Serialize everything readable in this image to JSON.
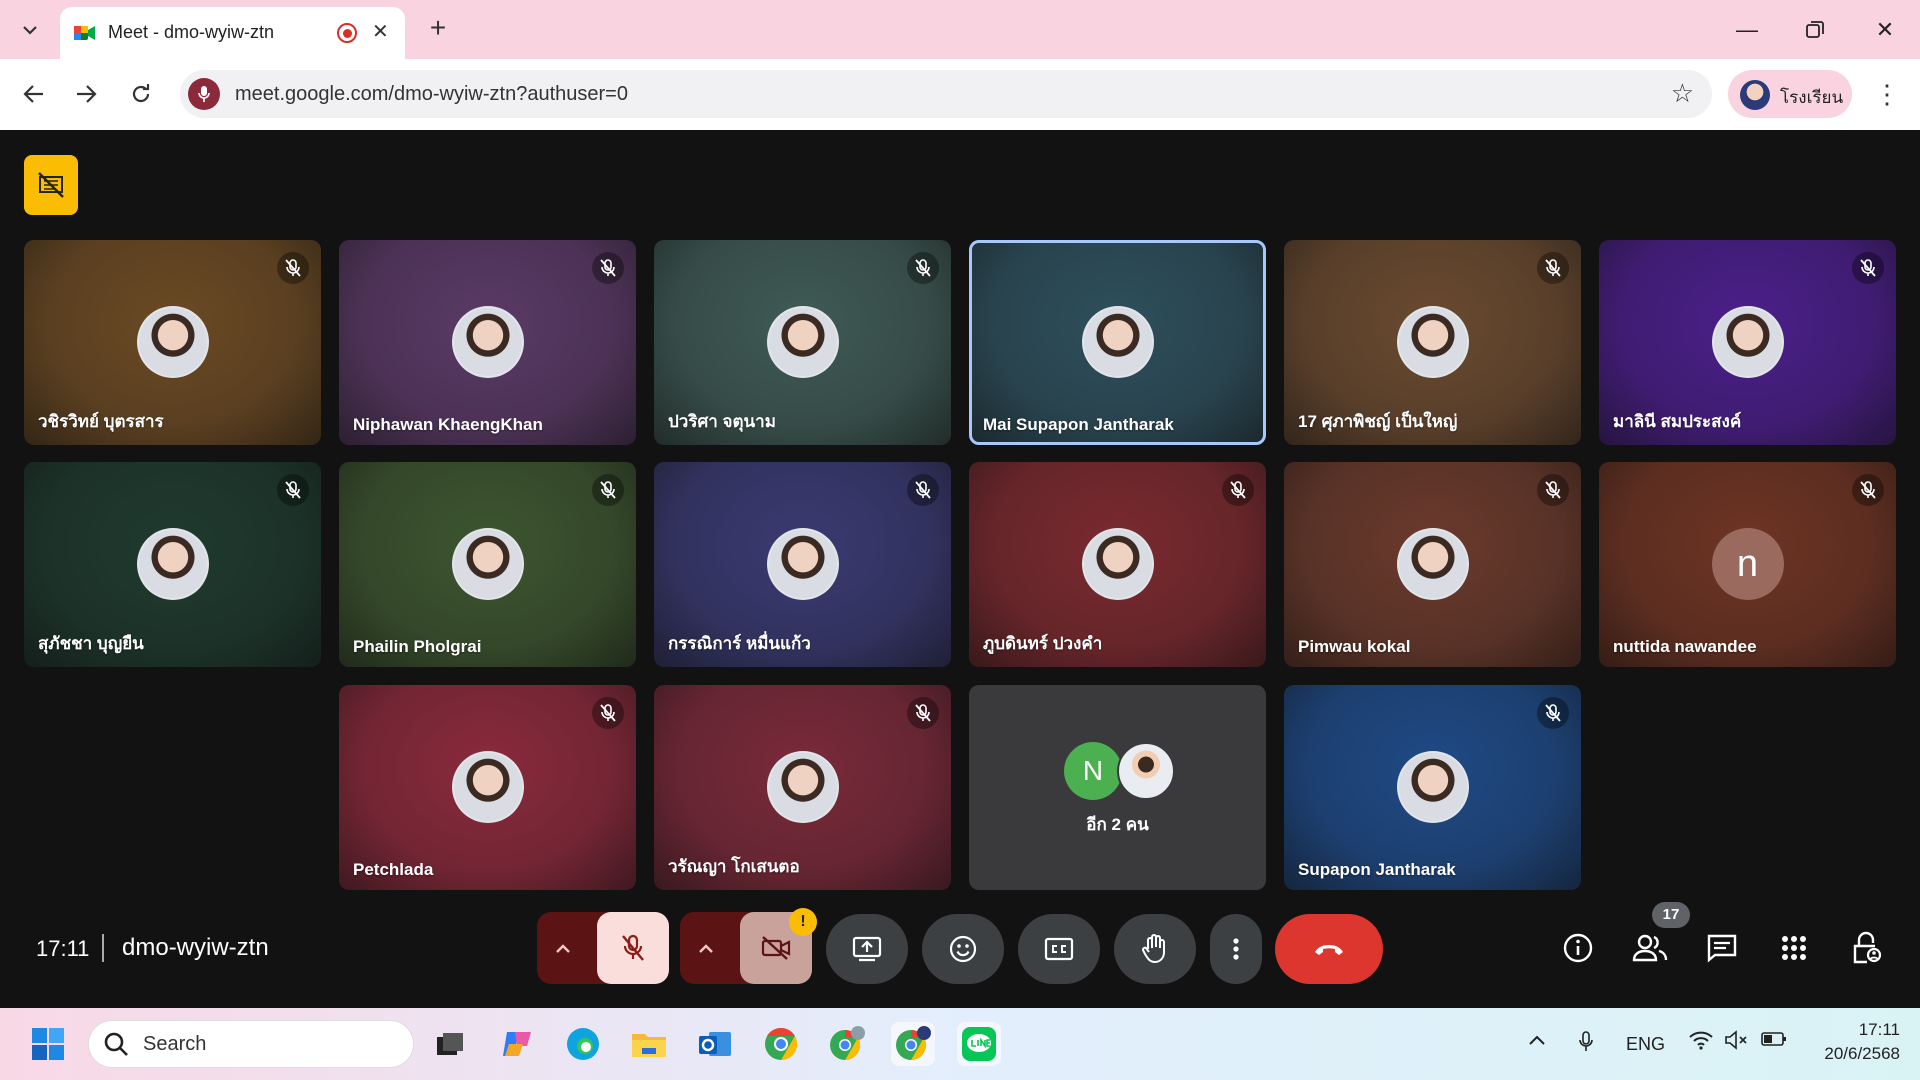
{
  "browser": {
    "tab_title": "Meet - dmo-wyiw-ztn",
    "url": "meet.google.com/dmo-wyiw-ztn?authuser=0",
    "profile_name": "โรงเรียน"
  },
  "meeting": {
    "time": "17:11",
    "code": "dmo-wyiw-ztn",
    "participant_count": "17",
    "overflow_label": "อีก 2 คน",
    "overflow_initial": "N"
  },
  "participants": [
    {
      "name": "วชิรวิทย์ บุตรสาร",
      "muted": true,
      "color": "#6b4a24"
    },
    {
      "name": "Niphawan KhaengKhan",
      "muted": true,
      "color": "#5a3a66"
    },
    {
      "name": "ปวริศา จตุนาม",
      "muted": true,
      "color": "#3f5a55"
    },
    {
      "name": "Mai Supapon Jantharak",
      "muted": false,
      "active": true,
      "color": "#2e4f5c"
    },
    {
      "name": "17 ศุภาพิชญ์ เป็นใหญ่",
      "muted": true,
      "color": "#6a4a30"
    },
    {
      "name": "มาลินี สมประสงค์",
      "muted": true,
      "color": "#4b1f8a"
    },
    {
      "name": "สุภัชชา บุญยืน",
      "muted": true,
      "color": "#1f3a2f"
    },
    {
      "name": "Phailin Pholgrai",
      "muted": true,
      "color": "#3d5530"
    },
    {
      "name": "กรรณิการ์ หมื่นแก้ว",
      "muted": true,
      "color": "#3a3a72"
    },
    {
      "name": "ภูบดินทร์ ปวงคำ",
      "muted": true,
      "color": "#7a2a30"
    },
    {
      "name": "Pimwau kokal",
      "muted": true,
      "color": "#6a3a2c"
    },
    {
      "name": "nuttida nawandee",
      "muted": true,
      "initial": "n",
      "color": "#6e3424"
    },
    {
      "name": "Petchlada",
      "muted": true,
      "color": "#8a2a3c"
    },
    {
      "name": "วรัณญา โกเสนตอ",
      "muted": true,
      "color": "#7a2a3a"
    },
    {
      "name": "Supapon Jantharak",
      "muted": true,
      "color": "#1f4a86"
    }
  ],
  "taskbar": {
    "search_placeholder": "Search",
    "language": "ENG",
    "clock": "17:11",
    "date": "20/6/2568"
  }
}
